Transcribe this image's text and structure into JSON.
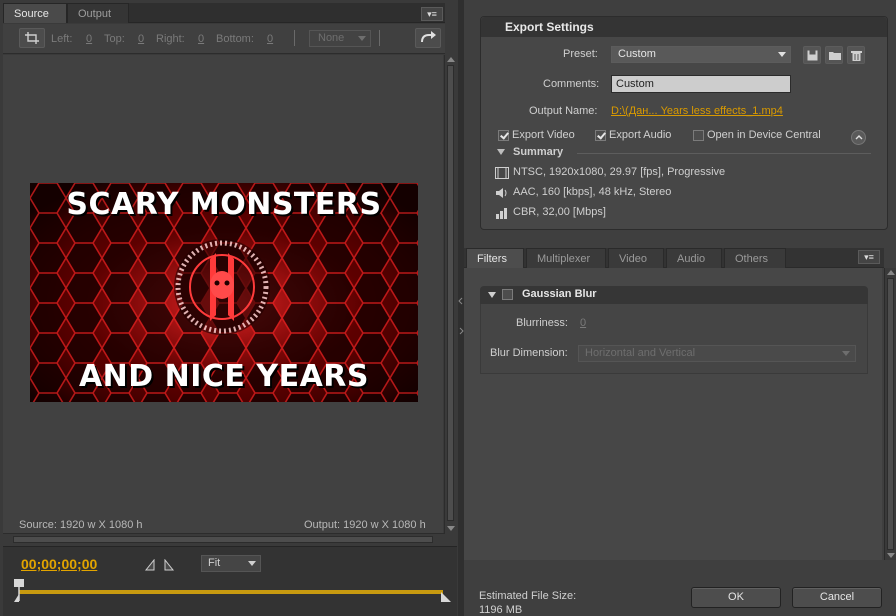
{
  "source_panel": {
    "tabs": [
      "Source",
      "Output"
    ],
    "crop": {
      "left_label": "Left:",
      "left_value": "0",
      "top_label": "Top:",
      "top_value": "0",
      "right_label": "Right:",
      "right_value": "0",
      "bottom_label": "Bottom:",
      "bottom_value": "0",
      "ratio_value": "None"
    },
    "video": {
      "title_line1": "SCARY MONSTERS",
      "title_line2": "AND NICE YEARS"
    },
    "source_info": "Source: 1920 w X 1080 h",
    "output_info": "Output: 1920 w X 1080 h",
    "timecode": "00;00;00;00",
    "zoom": "Fit"
  },
  "export_settings": {
    "title": "Export Settings",
    "preset_label": "Preset:",
    "preset_value": "Custom",
    "comments_label": "Comments:",
    "comments_value": "Custom",
    "output_name_label": "Output Name:",
    "output_name_value": "D:\\(Дан... Years less effects_1.mp4",
    "export_video_label": "Export Video",
    "export_video_checked": true,
    "export_audio_label": "Export Audio",
    "export_audio_checked": true,
    "device_central_label": "Open in Device Central",
    "device_central_checked": false,
    "summary_label": "Summary",
    "summary": {
      "video": "NTSC, 1920x1080, 29.97 [fps], Progressive",
      "audio": "AAC, 160 [kbps], 48 kHz, Stereo",
      "bitrate": "CBR, 32,00 [Mbps]"
    }
  },
  "settings_tabs": [
    "Filters",
    "Multiplexer",
    "Video",
    "Audio",
    "Others"
  ],
  "filters": {
    "filter_name": "Gaussian Blur",
    "blurriness_label": "Blurriness:",
    "blurriness_value": "0",
    "blur_dimension_label": "Blur Dimension:",
    "blur_dimension_value": "Horizontal and Vertical"
  },
  "footer": {
    "estimated_label": "Estimated File Size:",
    "estimated_value": "1196 MB",
    "ok_label": "OK",
    "cancel_label": "Cancel"
  },
  "colors": {
    "accent_timecode": "#e2a400",
    "output_link": "#d99a00",
    "panel_bg": "#3f3f3f"
  }
}
